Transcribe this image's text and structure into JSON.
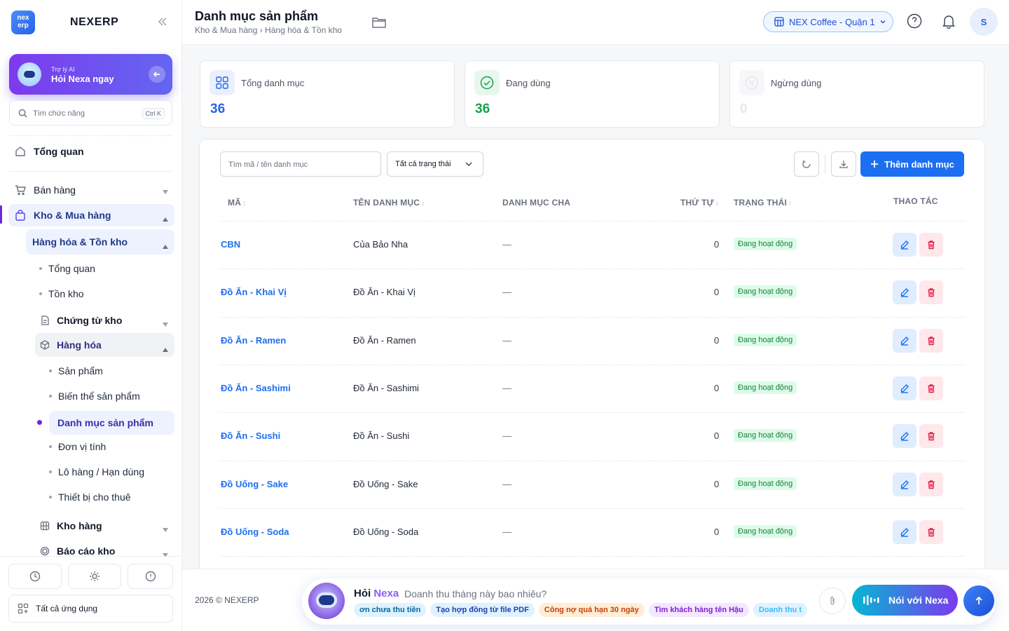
{
  "app": {
    "logo_text": "nex erp",
    "brand": "NEXERP"
  },
  "ai_card": {
    "small": "Trợ lý AI",
    "big": "Hỏi Nexa ngay"
  },
  "side_search": {
    "placeholder": "Tìm chức năng",
    "shortcut": "Ctrl K"
  },
  "nav": {
    "overview": "Tổng quan",
    "sales": "Bán hàng",
    "warehouse": "Kho & Mua hàng",
    "goods_inventory": "Hàng hóa & Tồn kho",
    "sub_overview": "Tổng quan",
    "stock": "Tồn kho",
    "stock_docs": "Chứng từ kho",
    "goods": "Hàng hóa",
    "products": "Sản phẩm",
    "variants": "Biến thể sản phẩm",
    "categories": "Danh mục sản phẩm",
    "units": "Đơn vị tính",
    "lots": "Lô hàng / Hạn dùng",
    "rental": "Thiết bị cho thuê",
    "warehouses": "Kho hàng",
    "reports": "Báo cáo kho"
  },
  "side_bottom": {
    "all_apps": "Tất cả ứng dụng"
  },
  "header": {
    "title": "Danh mục sản phẩm",
    "breadcrumb": "Kho & Mua hàng › Hàng hóa & Tồn kho",
    "branch": "NEX Coffee - Quận 1",
    "avatar": "S"
  },
  "stats": [
    {
      "label": "Tổng danh mục",
      "value": "36",
      "color": "#2563eb"
    },
    {
      "label": "Đang dùng",
      "value": "36",
      "color": "#16a34a"
    },
    {
      "label": "Ngừng dùng",
      "value": "0",
      "color": "#d1d5db"
    }
  ],
  "toolbar": {
    "search_placeholder": "Tìm mã / tên danh mục",
    "status_filter": "Tất cả trạng thái",
    "add_label": "Thêm danh mục"
  },
  "table": {
    "columns": {
      "code": "MÃ",
      "name": "TÊN DANH MỤC",
      "parent": "DANH MỤC CHA",
      "order": "THỨ TỰ",
      "status": "TRẠNG THÁI",
      "actions": "THAO TÁC"
    },
    "rows": [
      {
        "code": "CBN",
        "name": "Của Bảo Nha",
        "parent": "—",
        "order": "0",
        "status": "Đang hoạt động"
      },
      {
        "code": "Đồ Ăn - Khai Vị",
        "name": "Đồ Ăn - Khai Vị",
        "parent": "—",
        "order": "0",
        "status": "Đang hoạt động"
      },
      {
        "code": "Đồ Ăn - Ramen",
        "name": "Đồ Ăn - Ramen",
        "parent": "—",
        "order": "0",
        "status": "Đang hoạt động"
      },
      {
        "code": "Đồ Ăn - Sashimi",
        "name": "Đồ Ăn - Sashimi",
        "parent": "—",
        "order": "0",
        "status": "Đang hoạt động"
      },
      {
        "code": "Đồ Ăn - Sushi",
        "name": "Đồ Ăn - Sushi",
        "parent": "—",
        "order": "0",
        "status": "Đang hoạt động"
      },
      {
        "code": "Đồ Uống - Sake",
        "name": "Đồ Uống - Sake",
        "parent": "—",
        "order": "0",
        "status": "Đang hoạt động"
      },
      {
        "code": "Đồ Uống - Soda",
        "name": "Đồ Uống - Soda",
        "parent": "—",
        "order": "0",
        "status": "Đang hoạt động"
      }
    ]
  },
  "footer": {
    "copyright": "2026 © NEXERP",
    "ask_prefix": "Hỏi",
    "ask_brand": "Nexa",
    "ask_question": "Doanh thu tháng này bao nhiêu?",
    "chips": [
      {
        "label": "ơn chưa thu tiền",
        "bg": "#e0f2fe",
        "fg": "#0369a1"
      },
      {
        "label": "Tạo hợp đồng từ file PDF",
        "bg": "#e0f2fe",
        "fg": "#1e40af"
      },
      {
        "label": "Công nợ quá hạn 30 ngày",
        "bg": "#ffedd5",
        "fg": "#c2410c"
      },
      {
        "label": "Tìm khách hàng tên Hậu",
        "bg": "#f3e8ff",
        "fg": "#7e22ce"
      },
      {
        "label": "Doanh thu t",
        "bg": "#e0f2fe",
        "fg": "#38bdf8"
      }
    ],
    "talk_label": "Nói với Nexa"
  }
}
